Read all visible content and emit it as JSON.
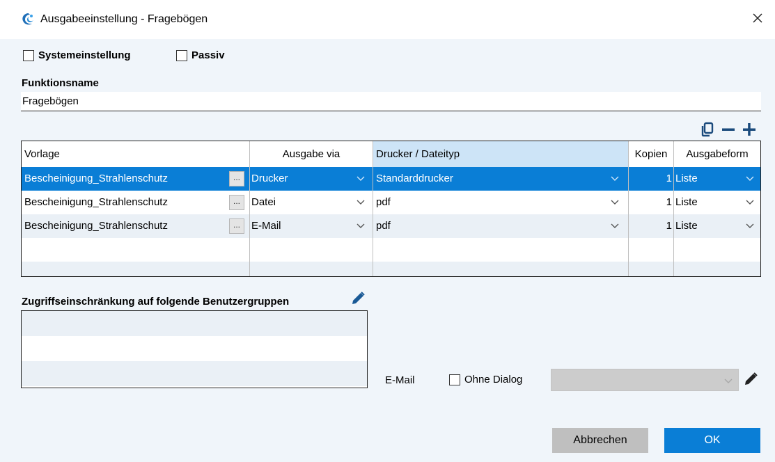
{
  "window": {
    "title": "Ausgabeeinstellung - Fragebögen",
    "icon": "app-logo-icon",
    "close_icon": "close-icon"
  },
  "options": {
    "systemeinstellung": "Systemeinstellung",
    "passiv": "Passiv"
  },
  "funktionsname": {
    "label": "Funktionsname",
    "value": "Fragebögen"
  },
  "table": {
    "toolbar_icons": [
      "copy-icon",
      "minus-icon",
      "plus-icon"
    ],
    "headers": {
      "vorlage": "Vorlage",
      "ausgabe_via": "Ausgabe via",
      "drucker": "Drucker / Dateityp",
      "kopien": "Kopien",
      "ausgabeform": "Ausgabeform"
    },
    "rows": [
      {
        "vorlage": "Bescheinigung_Strahlenschutz",
        "dots": "...",
        "ausgabe_via": "Drucker",
        "drucker": "Standarddrucker",
        "kopien": "1",
        "ausgabeform": "Liste"
      },
      {
        "vorlage": "Bescheinigung_Strahlenschutz",
        "dots": "...",
        "ausgabe_via": "Datei",
        "drucker": "pdf",
        "kopien": "1",
        "ausgabeform": "Liste"
      },
      {
        "vorlage": "Bescheinigung_Strahlenschutz",
        "dots": "...",
        "ausgabe_via": "E-Mail",
        "drucker": "pdf",
        "kopien": "1",
        "ausgabeform": "Liste"
      }
    ]
  },
  "groups": {
    "label": "Zugriffseinschränkung auf folgende Benutzergruppen",
    "edit_icon": "pencil-icon"
  },
  "email": {
    "label": "E-Mail",
    "ohne_dialog": "Ohne Dialog",
    "edit_icon": "pencil-icon"
  },
  "buttons": {
    "cancel": "Abbrechen",
    "ok": "OK"
  },
  "colors": {
    "accent": "#0a7ed6",
    "background": "#f0f5fa",
    "header_active": "#cde4f7",
    "row_alt": "#eaf0f6"
  }
}
